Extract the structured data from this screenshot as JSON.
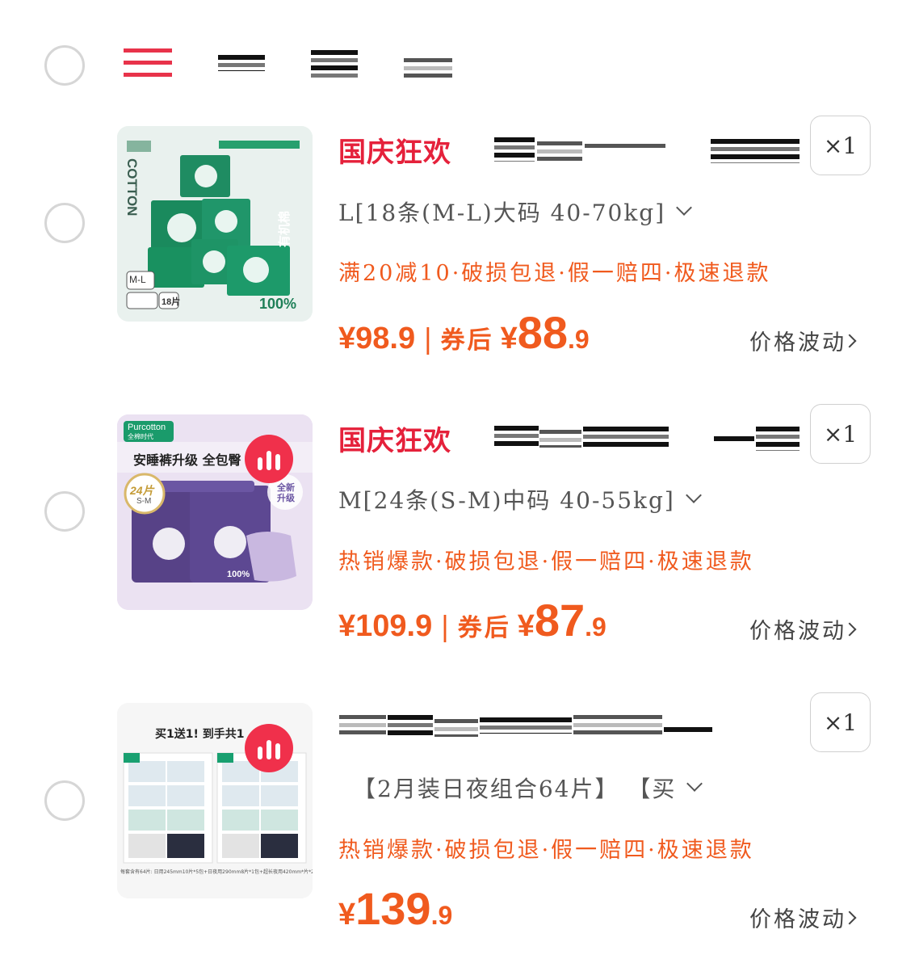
{
  "store": {
    "icon": "store-stripes-icon",
    "name_redacted": true
  },
  "items": [
    {
      "promo_tag": "国庆狂欢",
      "quantity": "×1",
      "spec": "L[18条(M-L)大码 40-70kg]",
      "tags": "满20减10·破损包退·假一赔四·极速退款",
      "price_original": "¥98.9",
      "price_separator": "|",
      "coupon_label": "券后",
      "price_yen": "¥",
      "price_int": "88",
      "price_dec": ".9",
      "trend_label": "价格波动",
      "thumb": {
        "brand_vertical": "COTTON",
        "size_badge": "M-L",
        "pack_badge": "18片",
        "corner_text": "有机棉",
        "percent": "100%"
      }
    },
    {
      "promo_tag": "国庆狂欢",
      "quantity": "×1",
      "spec": "M[24条(S-M)中码 40-55kg]",
      "tags": "热销爆款·破损包退·假一赔四·极速退款",
      "price_original": "¥109.9",
      "price_separator": "|",
      "coupon_label": "券后",
      "price_yen": "¥",
      "price_int": "87",
      "price_dec": ".9",
      "trend_label": "价格波动",
      "thumb": {
        "brand": "Purcotton",
        "brand_sub": "全棉时代",
        "headline": "安睡裤升级 全包臀",
        "pack_badge": "24片",
        "size_badge": "S-M",
        "new_badge": "全新升级",
        "percent": "100%"
      }
    },
    {
      "promo_tag": "",
      "quantity": "×1",
      "spec": "【2月装日夜组合64片】 【买",
      "tags": "热销爆款·破损包退·假一赔四·极速退款",
      "price_yen": "¥",
      "price_int": "139",
      "price_dec": ".9",
      "trend_label": "价格波动",
      "thumb": {
        "headline": "买1送1! 到手共1",
        "footnote": "每套含有64片: 日用245mm10片*5包+日夜用290mm8片*1包+超长夜用420mm*片*2包"
      }
    }
  ],
  "colors": {
    "accent_red": "#e5213b",
    "price_orange": "#f05a1e",
    "thumb1_bg": "#e7f0ec",
    "thumb2_bg": "#e7ddf0"
  }
}
